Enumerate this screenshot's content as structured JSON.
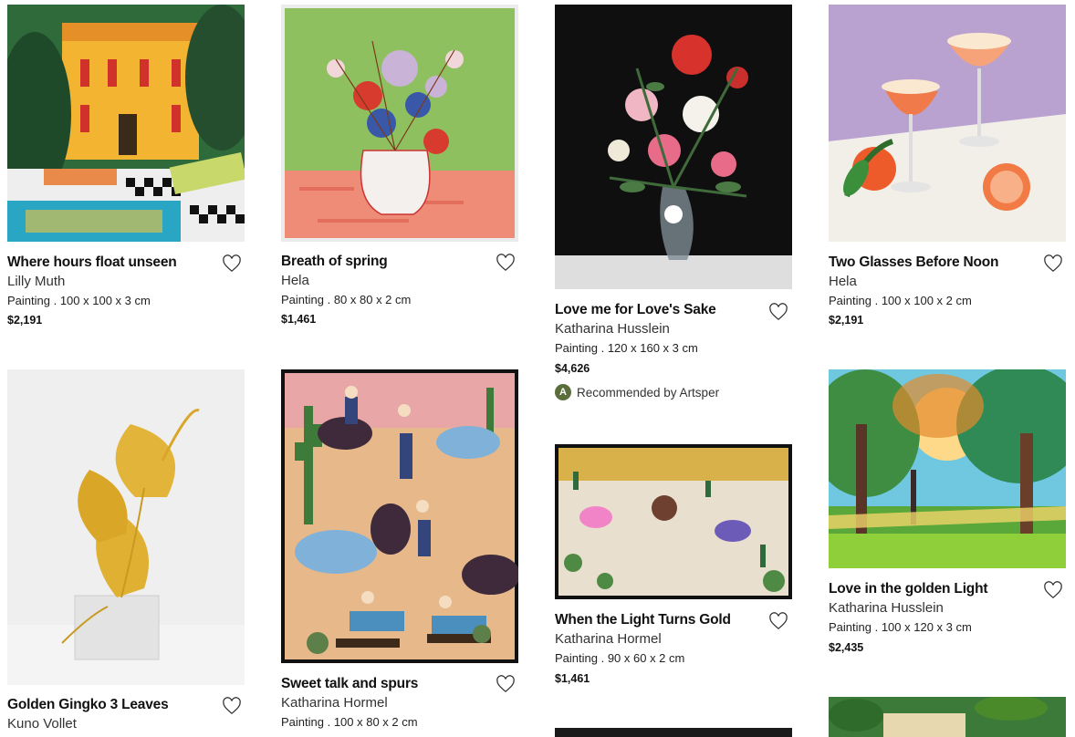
{
  "artworks": [
    {
      "title": "Where hours float unseen",
      "artist": "Lilly Muth",
      "details": "Painting . 100 x 100 x 3 cm",
      "price": "$2,191"
    },
    {
      "title": "Breath of spring",
      "artist": "Hela",
      "details": "Painting . 80 x 80 x 2 cm",
      "price": "$1,461"
    },
    {
      "title": "Love me for Love's Sake",
      "artist": "Katharina Husslein",
      "details": "Painting . 120 x 160 x 3 cm",
      "price": "$4,626",
      "recommended": "Recommended by Artsper"
    },
    {
      "title": "Two Glasses Before Noon",
      "artist": "Hela",
      "details": "Painting . 100 x 100 x 2 cm",
      "price": "$2,191"
    },
    {
      "title": "Golden Gingko 3 Leaves",
      "artist": "Kuno Vollet",
      "details": "",
      "price": ""
    },
    {
      "title": "Sweet talk and spurs",
      "artist": "Katharina Hormel",
      "details": "Painting . 100 x 80 x 2 cm",
      "price": ""
    },
    {
      "title": "When the Light Turns Gold",
      "artist": "Katharina Hormel",
      "details": "Painting . 90 x 60 x 2 cm",
      "price": "$1,461"
    },
    {
      "title": "Love in the golden Light",
      "artist": "Katharina Husslein",
      "details": "Painting . 100 x 120 x 3 cm",
      "price": "$2,435"
    }
  ],
  "icons": {
    "favorite": "heart-outline-icon",
    "recommended_badge": "artsper-logo-icon"
  },
  "recommended_badge_letter": "A"
}
